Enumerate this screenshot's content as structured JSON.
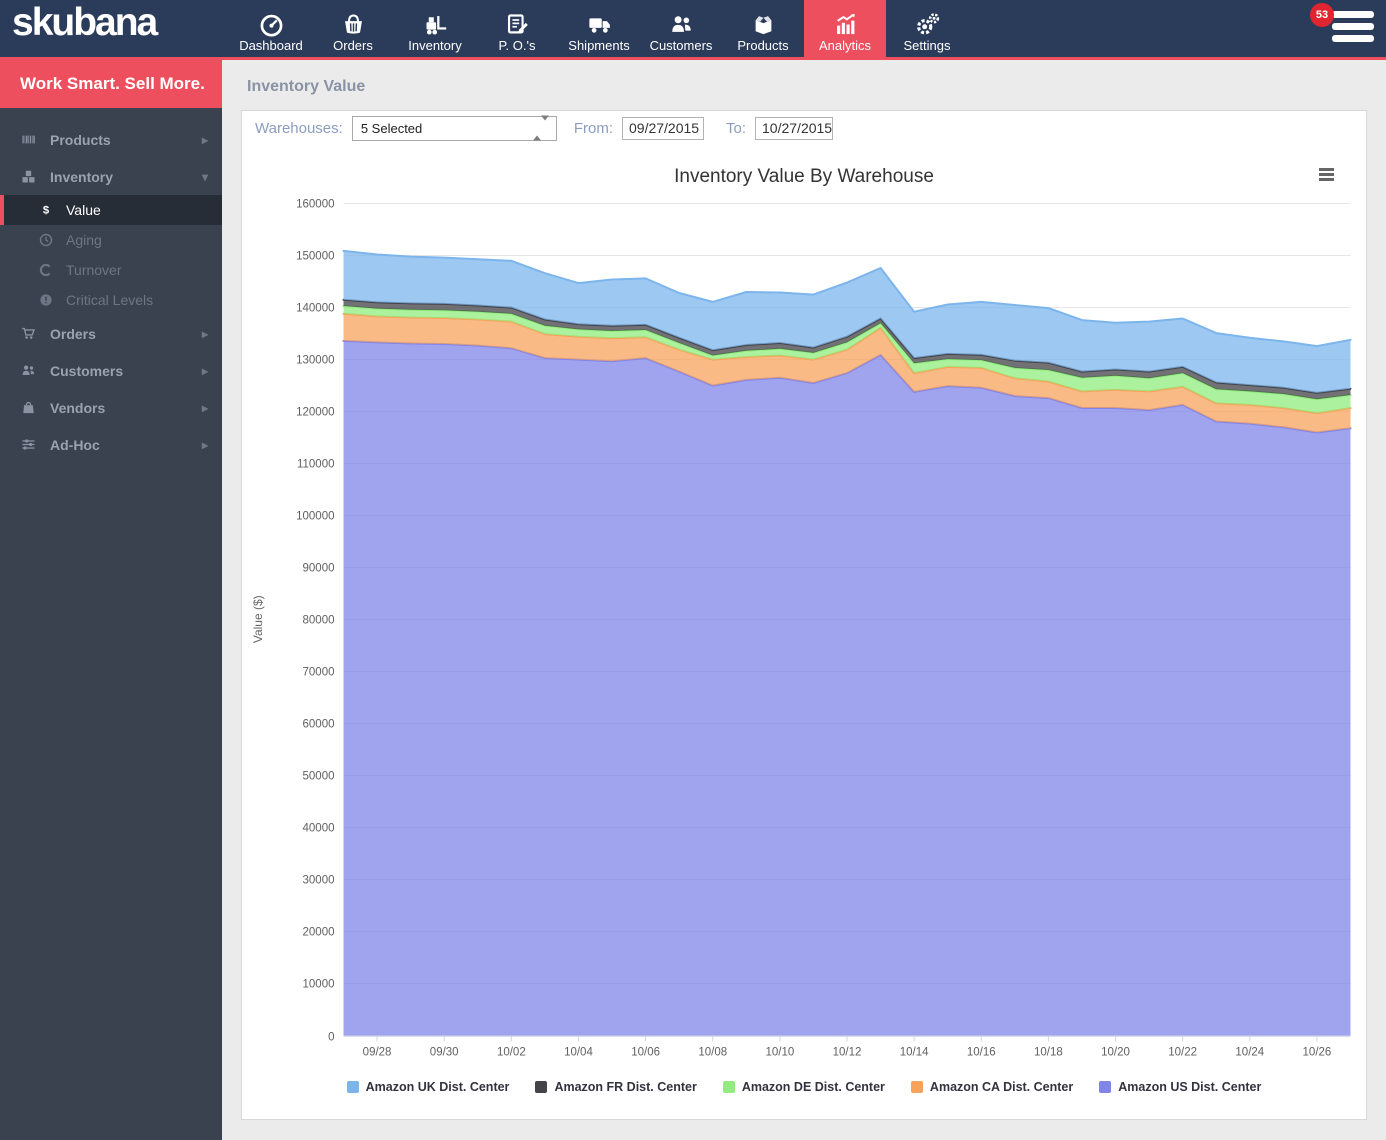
{
  "brand": {
    "logo_text": "skubana",
    "tagline": "Work Smart. Sell More."
  },
  "theme": {
    "navy": "#2b3b5a",
    "accent_red": "#ee4f5e",
    "sidebar_bg": "#3a4250",
    "content_bg": "#ebebeb"
  },
  "navbar": {
    "badge_count": "53",
    "items": [
      {
        "id": "dashboard",
        "label": "Dashboard",
        "icon": "gauge-icon",
        "active": false
      },
      {
        "id": "orders",
        "label": "Orders",
        "icon": "basket-icon",
        "active": false
      },
      {
        "id": "inventory",
        "label": "Inventory",
        "icon": "forklift-icon",
        "active": false
      },
      {
        "id": "pos",
        "label": "P. O.'s",
        "icon": "purchase-order-icon",
        "active": false
      },
      {
        "id": "shipments",
        "label": "Shipments",
        "icon": "truck-icon",
        "active": false
      },
      {
        "id": "customers",
        "label": "Customers",
        "icon": "people-icon",
        "active": false
      },
      {
        "id": "products",
        "label": "Products",
        "icon": "product-box-icon",
        "active": false
      },
      {
        "id": "analytics",
        "label": "Analytics",
        "icon": "analytics-bars-icon",
        "active": true
      },
      {
        "id": "settings",
        "label": "Settings",
        "icon": "settings-gears-icon",
        "active": false
      }
    ]
  },
  "sidebar": {
    "items": [
      {
        "id": "products",
        "label": "Products",
        "icon": "barcode-icon",
        "chevron": "right"
      },
      {
        "id": "inventory",
        "label": "Inventory",
        "icon": "inventory-cubes-icon",
        "chevron": "down",
        "children": [
          {
            "id": "value",
            "label": "Value",
            "icon": "dollar-icon",
            "active": true
          },
          {
            "id": "aging",
            "label": "Aging",
            "icon": "clock-icon",
            "active": false
          },
          {
            "id": "turnover",
            "label": "Turnover",
            "icon": "refresh-icon",
            "active": false
          },
          {
            "id": "critical-levels",
            "label": "Critical Levels",
            "icon": "alert-icon",
            "active": false
          }
        ]
      },
      {
        "id": "orders",
        "label": "Orders",
        "icon": "cart-icon",
        "chevron": "right"
      },
      {
        "id": "customers",
        "label": "Customers",
        "icon": "users-icon",
        "chevron": "right"
      },
      {
        "id": "vendors",
        "label": "Vendors",
        "icon": "vendor-bag-icon",
        "chevron": "right"
      },
      {
        "id": "ad-hoc",
        "label": "Ad-Hoc",
        "icon": "sliders-icon",
        "chevron": "right"
      }
    ]
  },
  "page": {
    "title": "Inventory Value"
  },
  "filters": {
    "warehouses_label": "Warehouses:",
    "warehouses_value": "5 Selected",
    "from_label": "From:",
    "from_value": "09/27/2015",
    "to_label": "To:",
    "to_value": "10/27/2015"
  },
  "chart_data": {
    "type": "area",
    "stacked": true,
    "title": "Inventory Value By Warehouse",
    "xlabel": "",
    "ylabel": "Value ($)",
    "ylim": [
      0,
      160000
    ],
    "ytick_interval": 10000,
    "grid": true,
    "legend_position": "bottom",
    "fill_opacity": 0.75,
    "xtick_every": 2,
    "xtick_start_index": 1,
    "x": [
      "09/27",
      "09/28",
      "09/29",
      "09/30",
      "10/01",
      "10/02",
      "10/03",
      "10/04",
      "10/05",
      "10/06",
      "10/07",
      "10/08",
      "10/09",
      "10/10",
      "10/11",
      "10/12",
      "10/13",
      "10/14",
      "10/15",
      "10/16",
      "10/17",
      "10/18",
      "10/19",
      "10/20",
      "10/21",
      "10/22",
      "10/23",
      "10/24",
      "10/25",
      "10/26",
      "10/27"
    ],
    "stack_bottom_to_top": [
      "Amazon US Dist. Center",
      "Amazon CA Dist. Center",
      "Amazon DE Dist. Center",
      "Amazon FR Dist. Center",
      "Amazon UK Dist. Center"
    ],
    "series": [
      {
        "name": "Amazon UK Dist. Center",
        "color": "#7cb5ec",
        "values": [
          9400,
          9200,
          9000,
          8900,
          8900,
          9000,
          8900,
          7900,
          8900,
          8900,
          8600,
          9300,
          10200,
          9700,
          10200,
          10400,
          9700,
          8900,
          9500,
          10200,
          10700,
          10500,
          9900,
          9000,
          9600,
          9300,
          9500,
          9100,
          8900,
          9000,
          9400
        ]
      },
      {
        "name": "Amazon FR Dist. Center",
        "color": "#434348",
        "values": [
          1200,
          1200,
          1200,
          1200,
          1200,
          1200,
          1200,
          1000,
          1000,
          1000,
          1000,
          1000,
          1100,
          1100,
          1000,
          1100,
          900,
          1000,
          1000,
          1000,
          1400,
          1400,
          1200,
          1200,
          1300,
          1200,
          1300,
          1200,
          1200,
          1200,
          1200
        ]
      },
      {
        "name": "Amazon DE Dist. Center",
        "color": "#90ed7d",
        "values": [
          1500,
          1500,
          1500,
          1500,
          1500,
          1500,
          1600,
          1400,
          1400,
          1400,
          1300,
          800,
          1200,
          1300,
          1300,
          1400,
          900,
          1900,
          1500,
          1500,
          2000,
          2200,
          2600,
          2700,
          2500,
          2600,
          2700,
          2600,
          2700,
          2700,
          2500
        ]
      },
      {
        "name": "Amazon CA Dist. Center",
        "color": "#f7a35c",
        "values": [
          5200,
          5000,
          5000,
          5000,
          5000,
          5100,
          4600,
          4400,
          4400,
          4000,
          4200,
          5000,
          4400,
          4300,
          4500,
          4500,
          5200,
          3600,
          3700,
          3800,
          3400,
          3200,
          3200,
          3500,
          3600,
          3500,
          3500,
          3600,
          3700,
          3700,
          3900
        ]
      },
      {
        "name": "Amazon US Dist. Center",
        "color": "#8085e9",
        "values": [
          133500,
          133200,
          133000,
          132900,
          132600,
          132100,
          130200,
          129900,
          129600,
          130200,
          127600,
          124900,
          126000,
          126400,
          125400,
          127300,
          130800,
          123700,
          124800,
          124500,
          122900,
          122500,
          120600,
          120600,
          120200,
          121200,
          118000,
          117600,
          116900,
          115900,
          116700
        ]
      }
    ]
  }
}
